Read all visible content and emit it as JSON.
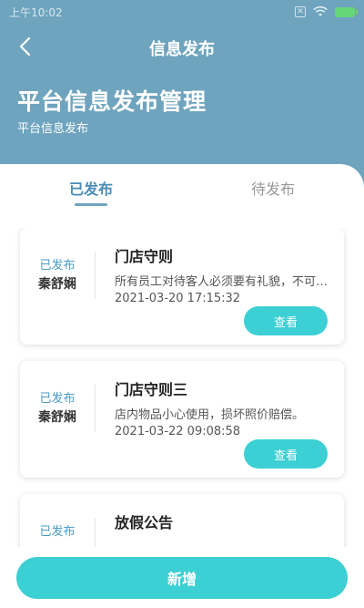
{
  "status_bar": {
    "time": "上午10:02",
    "icons": [
      "sim-off-icon",
      "wifi-icon",
      "battery-charging-icon"
    ]
  },
  "nav": {
    "back_icon": "chevron-left-icon",
    "title": "信息发布"
  },
  "header": {
    "title": "平台信息发布管理",
    "subtitle": "平台信息发布"
  },
  "tabs": [
    {
      "label": "已发布",
      "active": true
    },
    {
      "label": "待发布",
      "active": false
    }
  ],
  "cards": [
    {
      "status": "已发布",
      "author": "秦舒娴",
      "title": "门店守则",
      "description": "所有员工对待客人必须要有礼貌，不可以…",
      "time": "2021-03-20 17:15:32",
      "button": "查看"
    },
    {
      "status": "已发布",
      "author": "秦舒娴",
      "title": "门店守则三",
      "description": "店内物品小心使用，损坏照价赔偿。",
      "time": "2021-03-22 09:08:58",
      "button": "查看"
    },
    {
      "status": "已发布",
      "author": "",
      "title": "放假公告",
      "description": "",
      "time": "",
      "button": ""
    }
  ],
  "add_button": {
    "label": "新增"
  },
  "colors": {
    "header": "#6fa4bf",
    "accent": "#3ccfd3",
    "tab_active": "#4a8db8"
  }
}
